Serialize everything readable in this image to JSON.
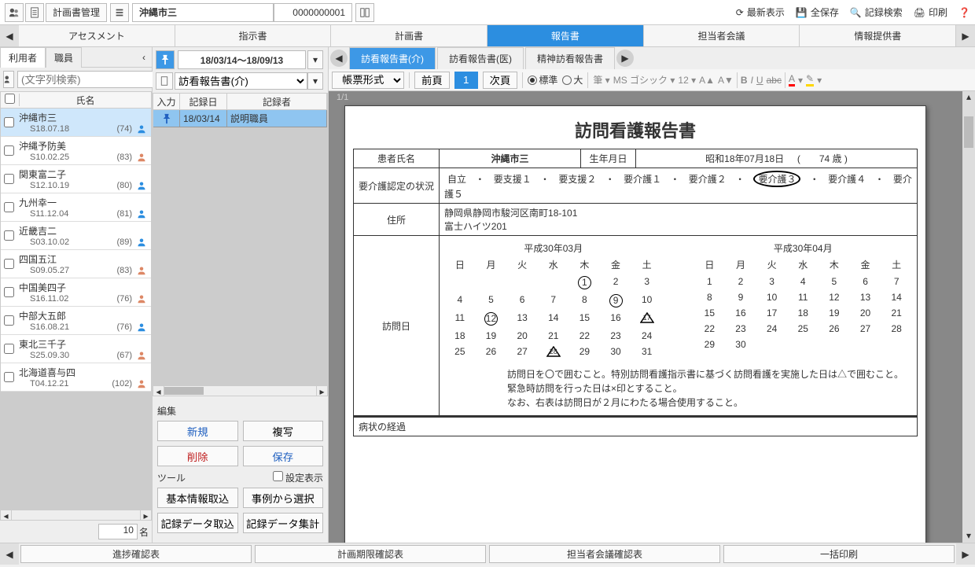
{
  "header": {
    "title": "計画書管理",
    "patient_name": "沖縄市三",
    "patient_id": "0000000001",
    "actions": {
      "refresh": "最新表示",
      "save_all": "全保存",
      "search_records": "記録検索",
      "print": "印刷"
    }
  },
  "main_tabs": [
    "アセスメント",
    "指示書",
    "計画書",
    "報告書",
    "担当者会議",
    "情報提供書"
  ],
  "main_tab_active": 3,
  "left": {
    "tabs": [
      "利用者",
      "職員"
    ],
    "tab_active": 0,
    "search_placeholder": "(文字列検索)",
    "col_name": "氏名",
    "rows": [
      {
        "name": "沖縄市三",
        "birth": "S18.07.18",
        "count": "(74)",
        "color": "#2c8ee0",
        "selected": true
      },
      {
        "name": "沖縄予防美",
        "birth": "S10.02.25",
        "count": "(83)",
        "color": "#d86"
      },
      {
        "name": "関東富二子",
        "birth": "S12.10.19",
        "count": "(80)",
        "color": "#2c8ee0"
      },
      {
        "name": "九州幸一",
        "birth": "S11.12.04",
        "count": "(81)",
        "color": "#2c8ee0"
      },
      {
        "name": "近畿吉二",
        "birth": "S03.10.02",
        "count": "(89)",
        "color": "#2c8ee0"
      },
      {
        "name": "四国五江",
        "birth": "S09.05.27",
        "count": "(83)",
        "color": "#d86"
      },
      {
        "name": "中国美四子",
        "birth": "S16.11.02",
        "count": "(76)",
        "color": "#d86"
      },
      {
        "name": "中部大五郎",
        "birth": "S16.08.21",
        "count": "(76)",
        "color": "#2c8ee0"
      },
      {
        "name": "東北三千子",
        "birth": "S25.09.30",
        "count": "(67)",
        "color": "#d86"
      },
      {
        "name": "北海道喜与四",
        "birth": "T04.12.21",
        "count": "(102)",
        "color": "#d86"
      }
    ],
    "count_value": "10",
    "count_unit": "名"
  },
  "center": {
    "date_range": "18/03/14～18/09/13",
    "select_value": "訪看報告書(介)",
    "grid_headers": [
      "入力",
      "記録日",
      "記録者"
    ],
    "grid_row": {
      "date": "18/03/14",
      "recorder": "説明職員"
    },
    "edit_label": "編集",
    "btn_new": "新規",
    "btn_copy": "複写",
    "btn_delete": "削除",
    "btn_save": "保存",
    "tools_label": "ツール",
    "chk_settings": "設定表示",
    "btn_basic": "基本情報取込",
    "btn_fromcase": "事例から選択",
    "btn_recimport": "記録データ取込",
    "btn_recsum": "記録データ集計"
  },
  "sub_tabs": [
    "訪看報告書(介)",
    "訪看報告書(医)",
    "精神訪看報告書"
  ],
  "sub_tab_active": 0,
  "toolbar": {
    "format_label": "帳票形式",
    "prev": "前頁",
    "page": "1",
    "next": "次頁",
    "radio_std": "標準",
    "radio_big": "大",
    "font_name": "MS ゴシック",
    "font_size": "12",
    "page_indicator": "1/1"
  },
  "document": {
    "title": "訪問看護報告書",
    "labels": {
      "patient_name": "患者氏名",
      "birth": "生年月日",
      "care_status": "要介護認定の状況",
      "address": "住所",
      "visit_days": "訪問日",
      "symptoms": "病状の経過"
    },
    "patient_name_val": "沖縄市三",
    "birth_val": "昭和18年07月18日",
    "age_val": "(　　74 歳 )",
    "care_levels": [
      "自立",
      "要支援１",
      "要支援２",
      "要介護１",
      "要介護２",
      "要介護３",
      "要介護４",
      "要介護５"
    ],
    "care_selected_index": 5,
    "address_val": "静岡県静岡市駿河区南町18-101\n富士ハイツ201",
    "cal1_title": "平成30年03月",
    "cal2_title": "平成30年04月",
    "dow": [
      "日",
      "月",
      "火",
      "水",
      "木",
      "金",
      "土"
    ],
    "cal1": [
      [
        "",
        "",
        "",
        "",
        "1",
        "2",
        "3"
      ],
      [
        "4",
        "5",
        "6",
        "7",
        "8",
        "9",
        "10"
      ],
      [
        "11",
        "12",
        "13",
        "14",
        "15",
        "16",
        "17"
      ],
      [
        "18",
        "19",
        "20",
        "21",
        "22",
        "23",
        "24"
      ],
      [
        "25",
        "26",
        "27",
        "28",
        "29",
        "30",
        "31"
      ]
    ],
    "cal1_circles": [
      "1",
      "9",
      "12"
    ],
    "cal1_triangles": [
      "17",
      "28"
    ],
    "cal2": [
      [
        "1",
        "2",
        "3",
        "4",
        "5",
        "6",
        "7"
      ],
      [
        "8",
        "9",
        "10",
        "11",
        "12",
        "13",
        "14"
      ],
      [
        "15",
        "16",
        "17",
        "18",
        "19",
        "20",
        "21"
      ],
      [
        "22",
        "23",
        "24",
        "25",
        "26",
        "27",
        "28"
      ],
      [
        "29",
        "30",
        "",
        "",
        "",
        "",
        ""
      ]
    ],
    "note1": "訪問日を〇で囲むこと。特別訪問看護指示書に基づく訪問看護を実施した日は△で囲むこと。",
    "note2": "緊急時訪問を行った日は×印とすること。",
    "note3": "なお、右表は訪問日が２月にわたる場合使用すること。"
  },
  "bottom": [
    "進捗確認表",
    "計画期限確認表",
    "担当者会議確認表",
    "一括印刷"
  ]
}
